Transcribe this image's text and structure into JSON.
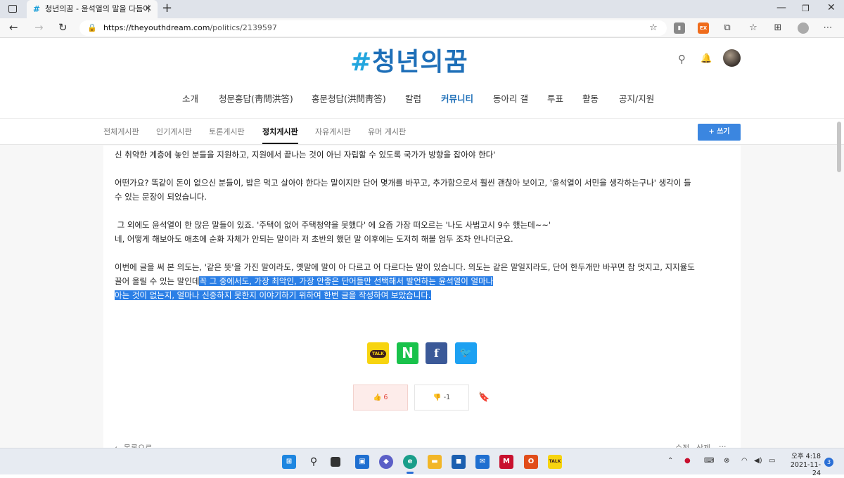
{
  "browser": {
    "tab_title": "청년의꿈 - 윤석열의 말을 다듬어",
    "tab_favicon": "#",
    "url_host": "https://theyouthdream.com",
    "url_path": "/politics/2139597"
  },
  "site": {
    "logo_hash": "#",
    "logo_text": "청년의꿈",
    "main_nav": [
      "소개",
      "청문홍답(靑問洪答)",
      "홍문청답(洪問靑答)",
      "칼럼",
      "커뮤니티",
      "동아리 갤",
      "투표",
      "활동",
      "공지/지원"
    ],
    "main_nav_active": "커뮤니티",
    "sub_nav": [
      "전체게시판",
      "인기게시판",
      "토론게시판",
      "정치게시판",
      "자유게시판",
      "유머 게시판"
    ],
    "sub_nav_active": "정치게시판",
    "write_button": "+ 쓰기"
  },
  "article": {
    "line1": "신 취약한 계층에 놓인 분들을 지원하고, 지원에서 끝나는 것이 아닌 자립할 수 있도록 국가가 방향을 잡아야 한다'",
    "p2_line1": "어떤가요? 똑같이 돈이 없으신 분들이, 밥은 먹고 살아야 한다는 말이지만 단어 몇개를 바꾸고, 추가함으로서 훨씬 괜찮아 보이고, '윤석열이 서민을 생각하는구나' 생각이 들",
    "p2_line2": "수 있는 문장이 되었습니다.",
    "p3_line1": " 그 외에도 윤석열이 한 많은 말들이 있죠. '주택이 없어 주택청약을 못했다' 에 요즘 가장 떠오르는 '나도 사법고시 9수 했는데~~'",
    "p3_line2": "네, 어떻게 해보아도 애초에 순화 자체가 안되는 말이라 저 초반의 했던 말 이후에는 도저히 해볼 엄두 조차 안나더군요.",
    "p4_line1": "이번에 글을 써 본 의도는, '같은 뜻'을 가진 말이라도, 옛말에 말이 아 다르고 어 다르다는 말이 있습니다. 의도는 같은 말일지라도, 단어 한두개만 바꾸면 참 멋지고, 지지율도",
    "p4_line2_plain": "끌어 올릴 수 있는 말인데",
    "p4_line2_highlight": "꼭 그 중에서도, 가장 최악인, 가장 안좋은 단어들만 선택해서 발언하는 윤석열이 얼마나",
    "p4_line3_highlight": "아는 것이 없는지, 얼마나 신중하지 못한지 이야기하기 위하여 한번 글을 작성하여 보았습니다."
  },
  "share": {
    "kakao_label": "TALK",
    "naver_label": "N",
    "facebook_label": "f",
    "twitter_label": "🐦"
  },
  "votes": {
    "up_count": "6",
    "down_count": "-1"
  },
  "footer": {
    "back_label": "← 목록으로",
    "edit_label": "수정",
    "delete_label": "삭제",
    "more_label": "···"
  },
  "taskbar": {
    "clock_time": "오후 4:18",
    "clock_date": "2021-11-24",
    "notification_count": "3"
  },
  "colors": {
    "accent": "#1e6fb8",
    "highlight": "#2b7fe6",
    "write_button": "#3b86e0"
  }
}
